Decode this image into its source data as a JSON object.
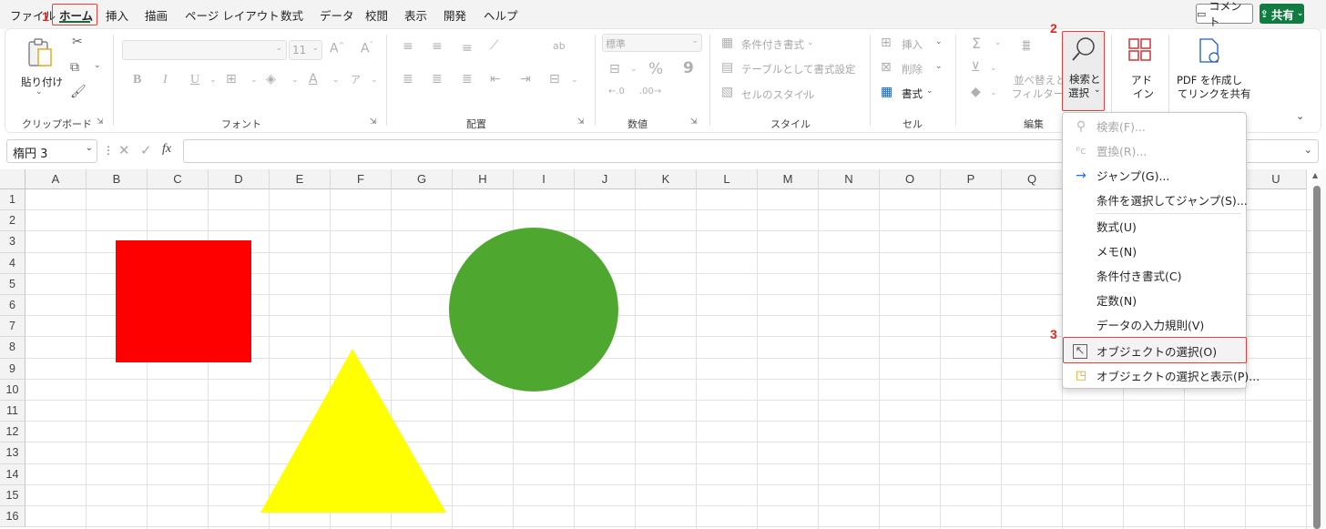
{
  "tabs": [
    {
      "label": "ファイル",
      "active": false
    },
    {
      "label": "ホーム",
      "active": true
    },
    {
      "label": "挿入",
      "active": false
    },
    {
      "label": "描画",
      "active": false
    },
    {
      "label": "ページ レイアウト",
      "active": false
    },
    {
      "label": "数式",
      "active": false
    },
    {
      "label": "データ",
      "active": false
    },
    {
      "label": "校閲",
      "active": false
    },
    {
      "label": "表示",
      "active": false
    },
    {
      "label": "開発",
      "active": false
    },
    {
      "label": "ヘルプ",
      "active": false
    }
  ],
  "header_buttons": {
    "comment": "コメント",
    "share": "共有"
  },
  "steps": {
    "s1": "1",
    "s2": "2",
    "s3": "3"
  },
  "ribbon": {
    "clipboard": {
      "paste": "貼り付け",
      "label": "クリップボード"
    },
    "font": {
      "name": "",
      "size": "11",
      "label": "フォント",
      "bold": "B",
      "italic": "I",
      "underline": "U"
    },
    "alignment": {
      "label": "配置"
    },
    "number": {
      "format": "標準",
      "percent": "%",
      "comma": "9",
      "label": "数値"
    },
    "styles": {
      "conditional": "条件付き書式",
      "table": "テーブルとして書式設定",
      "cell_styles": "セルのスタイル",
      "label": "スタイル"
    },
    "cells": {
      "insert": "挿入",
      "delete": "削除",
      "format": "書式",
      "label": "セル"
    },
    "editing": {
      "sum": "Σ",
      "sort_line1": "並べ替えと",
      "sort_line2": "フィルター",
      "find_line1": "検索と",
      "find_line2": "選択",
      "label": "編集"
    },
    "addins": {
      "line1": "アド",
      "line2": "イン"
    },
    "pdf": {
      "line1": "PDF を作成し",
      "line2": "てリンクを共有"
    }
  },
  "namebox": {
    "value": "楕円 3"
  },
  "formula": {
    "value": "",
    "fx": "fx"
  },
  "columns": [
    "A",
    "B",
    "C",
    "D",
    "E",
    "F",
    "G",
    "H",
    "I",
    "J",
    "K",
    "L",
    "M",
    "N",
    "O",
    "P",
    "Q",
    "R",
    "S",
    "T",
    "U"
  ],
  "rows": [
    "1",
    "2",
    "3",
    "4",
    "5",
    "6",
    "7",
    "8",
    "9",
    "10",
    "11",
    "12",
    "13",
    "14",
    "15",
    "16"
  ],
  "shapes": {
    "square_color": "#ff0000",
    "circle_color": "#4ea72e",
    "triangle_color": "#ffff00"
  },
  "menu": {
    "items": [
      {
        "label": "検索(F)...",
        "icon": "search-icon",
        "disabled": true
      },
      {
        "label": "置換(R)...",
        "icon": "replace-icon",
        "disabled": true
      },
      {
        "label": "ジャンプ(G)...",
        "icon": "arrow-right-icon",
        "disabled": false
      },
      {
        "label": "条件を選択してジャンプ(S)...",
        "icon": "",
        "disabled": false
      },
      {
        "label": "数式(U)",
        "icon": "",
        "disabled": false
      },
      {
        "label": "メモ(N)",
        "icon": "",
        "disabled": false
      },
      {
        "label": "条件付き書式(C)",
        "icon": "",
        "disabled": false
      },
      {
        "label": "定数(N)",
        "icon": "",
        "disabled": false
      },
      {
        "label": "データの入力規則(V)",
        "icon": "",
        "disabled": false
      },
      {
        "label": "オブジェクトの選択(O)",
        "icon": "select-objects-icon",
        "disabled": false,
        "highlighted": true
      },
      {
        "label": "オブジェクトの選択と表示(P)...",
        "icon": "selection-pane-icon",
        "disabled": false
      }
    ]
  },
  "colors": {
    "accent": "#107c41",
    "highlight_box": "#e0413c",
    "step_number": "#e0281f"
  }
}
